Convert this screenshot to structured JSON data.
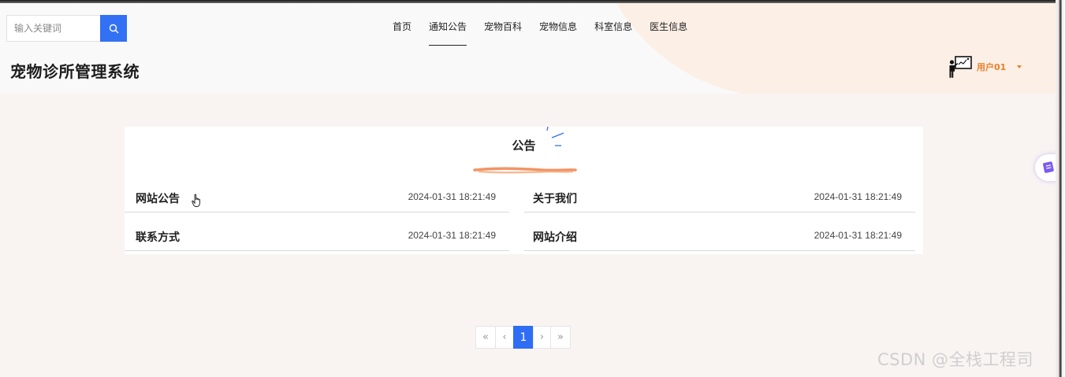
{
  "search": {
    "placeholder": "输入关键词",
    "icon": "search-icon"
  },
  "nav": {
    "items": [
      {
        "label": "首页"
      },
      {
        "label": "通知公告",
        "active": true
      },
      {
        "label": "宠物百科"
      },
      {
        "label": "宠物信息"
      },
      {
        "label": "科室信息"
      },
      {
        "label": "医生信息"
      }
    ]
  },
  "header": {
    "site_title": "宠物诊所管理系统"
  },
  "user": {
    "name": "用户01",
    "avatar_icon": "teacher-avatar-icon",
    "accent_color": "#e8802a"
  },
  "announcements": {
    "title": "公告",
    "items": [
      {
        "title": "网站公告",
        "time": "2024-01-31 18:21:49"
      },
      {
        "title": "关于我们",
        "time": "2024-01-31 18:21:49"
      },
      {
        "title": "联系方式",
        "time": "2024-01-31 18:21:49"
      },
      {
        "title": "网站介绍",
        "time": "2024-01-31 18:21:49"
      }
    ]
  },
  "pagination": {
    "first": "«",
    "prev": "‹",
    "current": "1",
    "next": "›",
    "last": "»",
    "active_color": "#2f6df5"
  },
  "watermark": "CSDN @全栈工程司",
  "colors": {
    "primary": "#3271f3",
    "background": "#f9f4f2",
    "header_accent": "#fcefe6"
  }
}
